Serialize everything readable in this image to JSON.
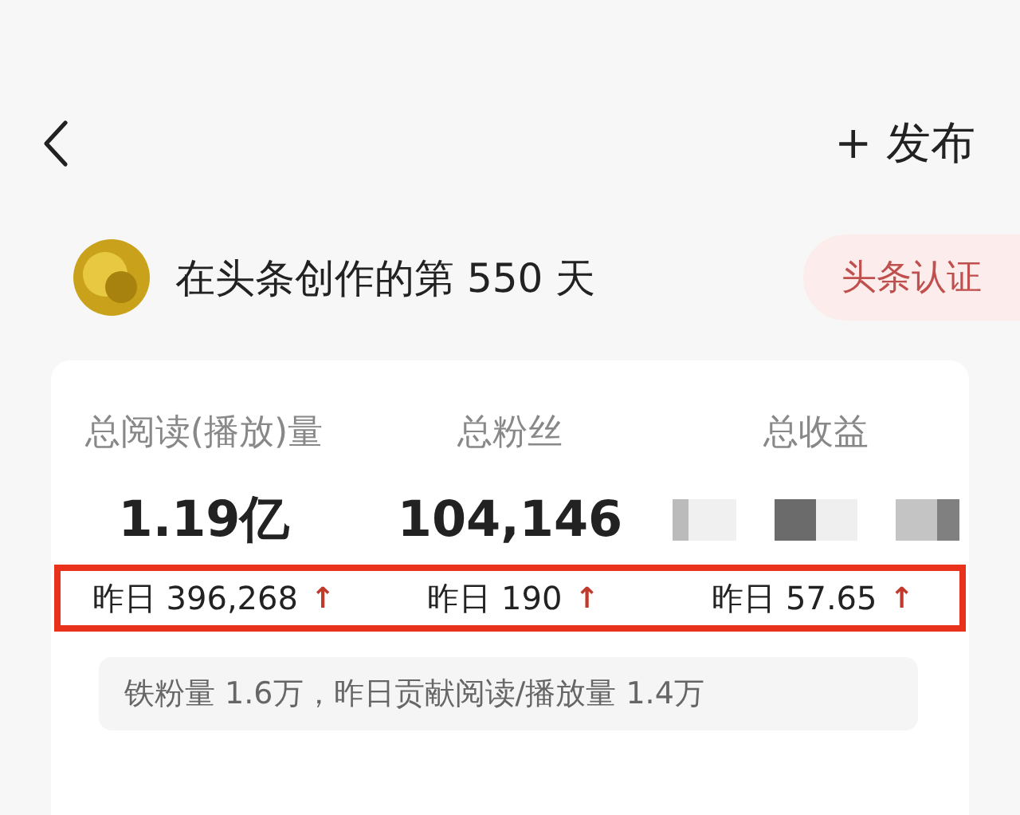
{
  "header": {
    "publish_button": "+ 发布"
  },
  "profile": {
    "title": "在头条创作的第 550 天",
    "badge": "头条认证"
  },
  "stats": [
    {
      "label": "总阅读(播放)量",
      "value": "1.19亿",
      "yesterday": "昨日 396,268",
      "trend": "↑",
      "value_hidden": false
    },
    {
      "label": "总粉丝",
      "value": "104,146",
      "yesterday": "昨日 190",
      "trend": "↑",
      "value_hidden": false
    },
    {
      "label": "总收益",
      "yesterday": "昨日 57.65",
      "trend": "↑",
      "value_hidden": true
    }
  ],
  "note": "铁粉量 1.6万，昨日贡献阅读/播放量 1.4万"
}
